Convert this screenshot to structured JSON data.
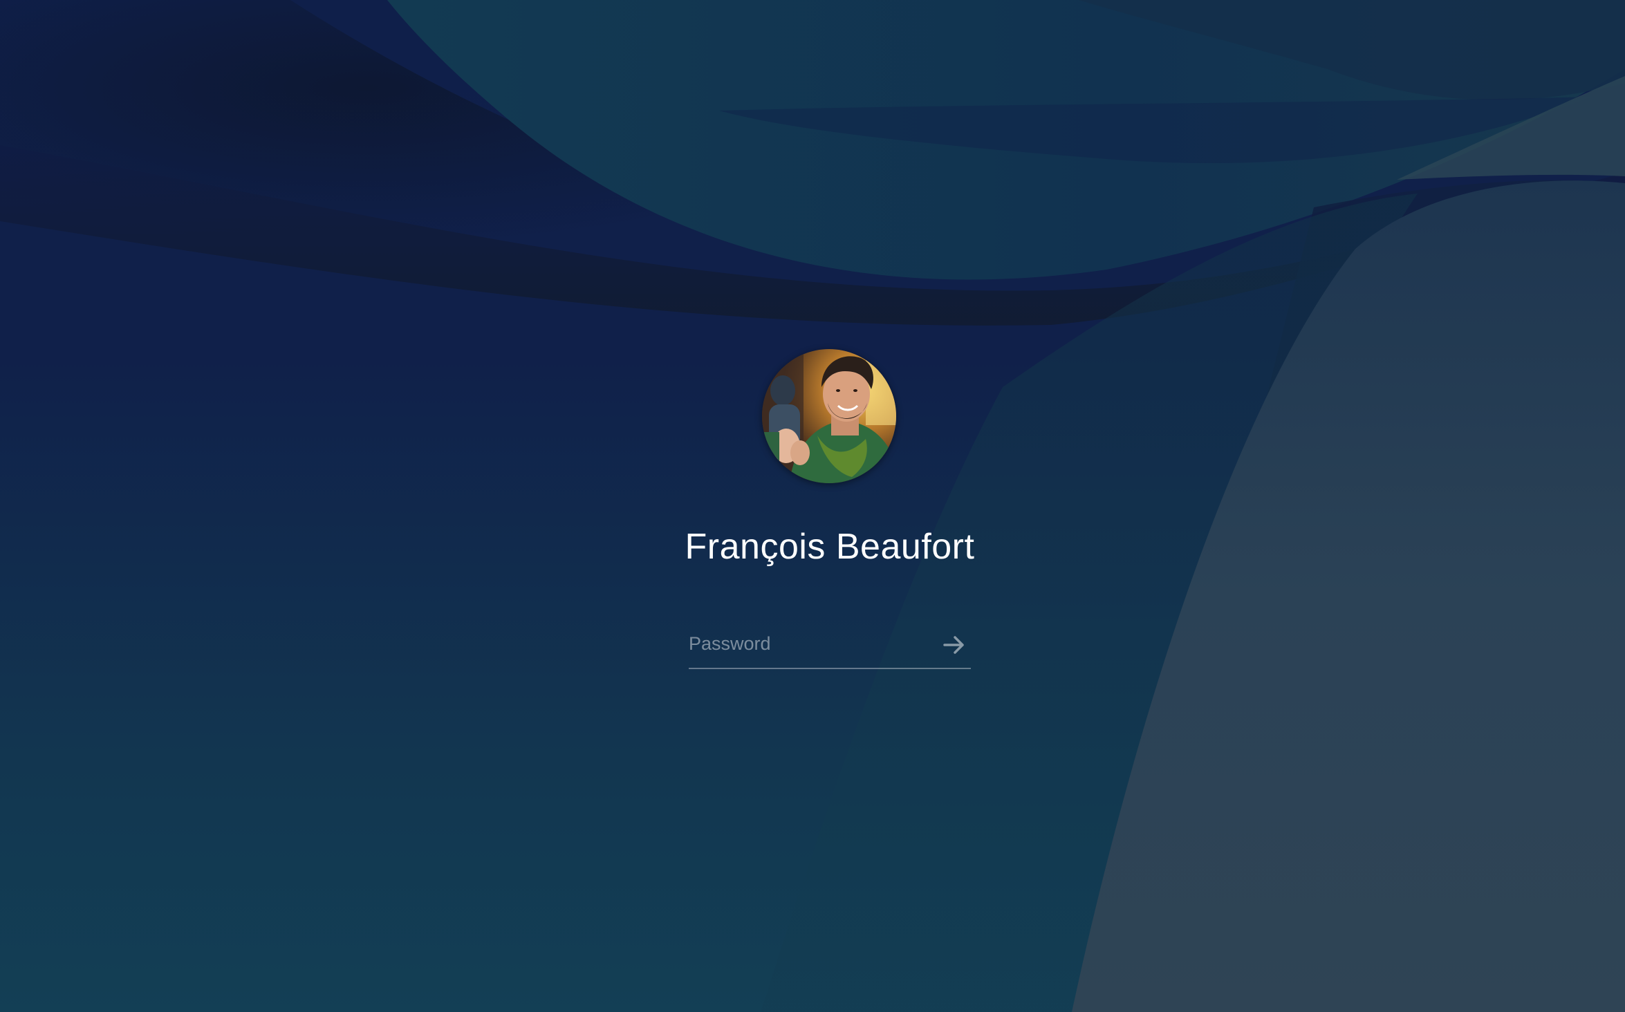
{
  "login": {
    "user_name": "François Beaufort",
    "password": {
      "value": "",
      "placeholder": "Password"
    },
    "submit_icon": "arrow-right-icon",
    "avatar_icon": "user-photo"
  },
  "colors": {
    "background_dark": "#0f1f4a",
    "background_teal": "#133f55",
    "curve_slate": "#2e4354",
    "text": "#ffffff"
  }
}
